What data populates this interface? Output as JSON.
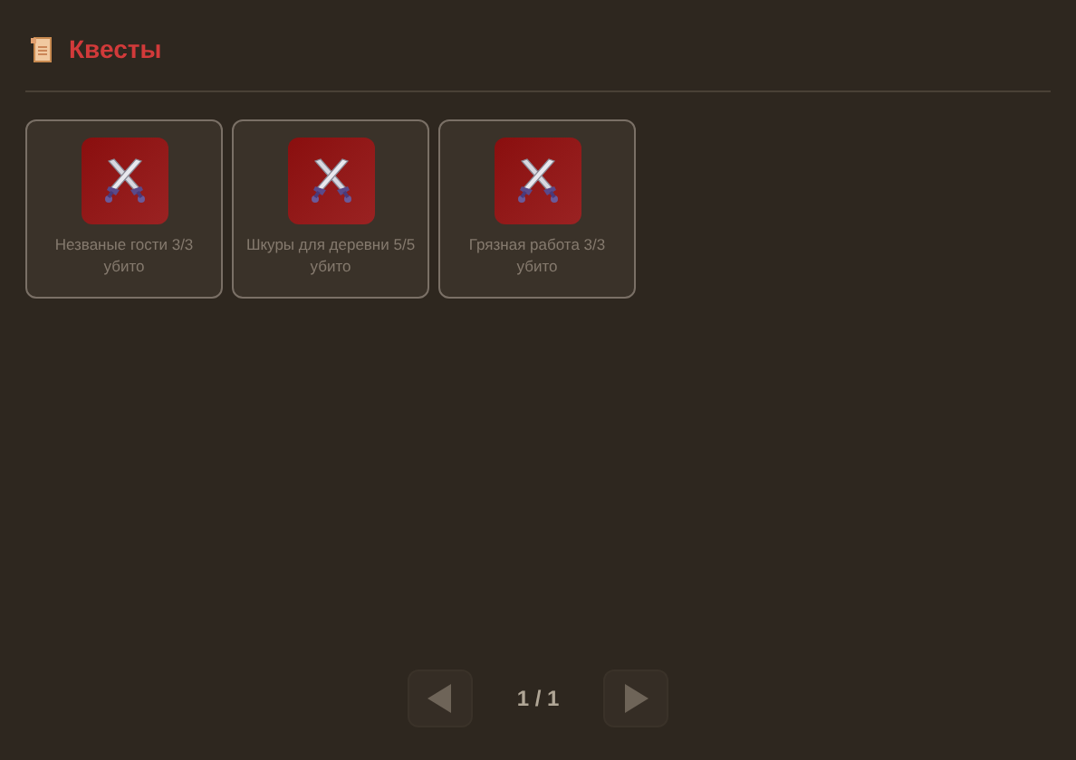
{
  "header": {
    "title": "Квесты"
  },
  "quests": [
    {
      "label": "Незваные гости 3/3 убито"
    },
    {
      "label": "Шкуры для деревни 5/5 убито"
    },
    {
      "label": "Грязная работа 3/3 убито"
    }
  ],
  "pagination": {
    "page": "1 / 1",
    "prev_disabled": true,
    "next_disabled": true
  }
}
